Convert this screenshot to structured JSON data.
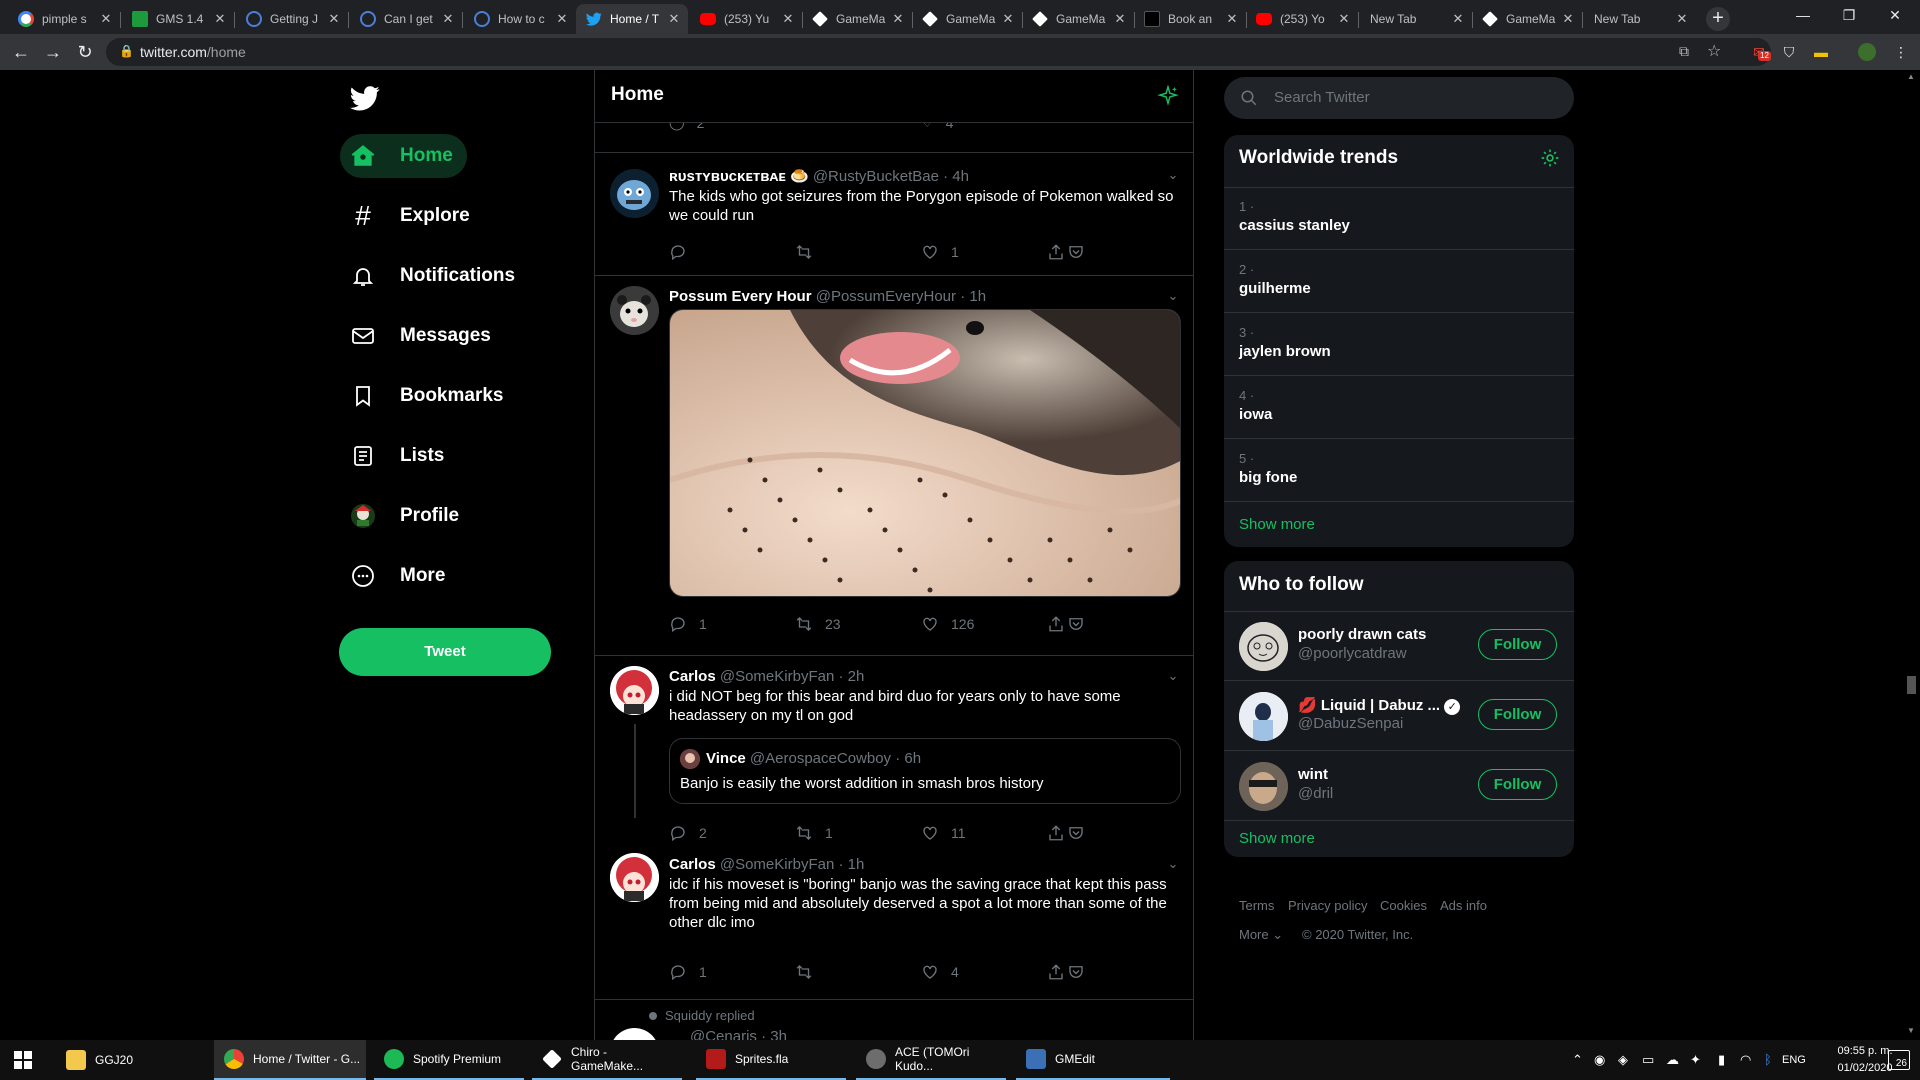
{
  "browser": {
    "tabs": [
      {
        "title": "pimple s"
      },
      {
        "title": "GMS 1.4"
      },
      {
        "title": "Getting J"
      },
      {
        "title": "Can I get"
      },
      {
        "title": "How to c"
      },
      {
        "title": "Home / T"
      },
      {
        "title": "(253) Yu"
      },
      {
        "title": "GameMa"
      },
      {
        "title": "GameMa"
      },
      {
        "title": "GameMa"
      },
      {
        "title": "Book an"
      },
      {
        "title": "(253) Yo"
      },
      {
        "title": "New Tab"
      },
      {
        "title": "GameMa"
      },
      {
        "title": "New Tab"
      }
    ],
    "url_host": "twitter.com",
    "url_path": "/home",
    "extension_badge": "12"
  },
  "nav": {
    "items": [
      {
        "label": "Home",
        "icon": "home-icon"
      },
      {
        "label": "Explore",
        "icon": "hashtag-icon"
      },
      {
        "label": "Notifications",
        "icon": "bell-icon"
      },
      {
        "label": "Messages",
        "icon": "envelope-icon"
      },
      {
        "label": "Bookmarks",
        "icon": "bookmark-icon"
      },
      {
        "label": "Lists",
        "icon": "list-icon"
      },
      {
        "label": "Profile",
        "icon": "profile-avatar-icon"
      },
      {
        "label": "More",
        "icon": "more-icon"
      }
    ],
    "tweet_button": "Tweet"
  },
  "feed": {
    "title": "Home",
    "top_partial_counts": {
      "replies": "2",
      "likes": "4"
    },
    "tweets": [
      {
        "name": "ʀᴜsᴛʏʙᴜᴄᴋᴇᴛʙᴀᴇ 🍮",
        "handle": "@RustyBucketBae",
        "time": "· 4h",
        "text": "The kids who got seizures from the Porygon episode of Pokemon walked so we could run",
        "replies": "",
        "retweets": "",
        "likes": "1"
      },
      {
        "name": "Possum Every Hour",
        "handle": "@PossumEveryHour",
        "time": "· 1h",
        "text": "",
        "replies": "1",
        "retweets": "23",
        "likes": "126"
      },
      {
        "name": "Carlos",
        "handle": "@SomeKirbyFan",
        "time": "· 2h",
        "text": "i did NOT beg for this bear and bird duo for years only to have some headassery on my tl on god",
        "quote": {
          "name": "Vince",
          "handle": "@AerospaceCowboy",
          "time": "· 6h",
          "text": "Banjo is easily the worst addition in smash bros history"
        },
        "replies": "2",
        "retweets": "1",
        "likes": "11"
      },
      {
        "name": "Carlos",
        "handle": "@SomeKirbyFan",
        "time": "· 1h",
        "text": "idc if his moveset is \"boring\" banjo was the saving grace that kept this pass from being mid and absolutely deserved a spot a lot more than some of the other dlc imo",
        "replies": "1",
        "retweets": "",
        "likes": "4"
      }
    ],
    "partial_next": {
      "context": "Squiddy replied",
      "handle": "@Cenaris · 3h"
    }
  },
  "sidebar": {
    "search_placeholder": "Search Twitter",
    "trends": {
      "title": "Worldwide trends",
      "items": [
        {
          "rank": "1 ·",
          "name": "cassius stanley"
        },
        {
          "rank": "2 ·",
          "name": "guilherme"
        },
        {
          "rank": "3 ·",
          "name": "jaylen brown"
        },
        {
          "rank": "4 ·",
          "name": "iowa"
        },
        {
          "rank": "5 ·",
          "name": "big fone"
        }
      ],
      "show_more": "Show more"
    },
    "who_to_follow": {
      "title": "Who to follow",
      "items": [
        {
          "name": "poorly drawn cats",
          "handle": "@poorlycatdraw",
          "button": "Follow"
        },
        {
          "name": "💋 Liquid | Dabuz ...",
          "handle": "@DabuzSenpai",
          "button": "Follow",
          "verified": true
        },
        {
          "name": "wint",
          "handle": "@dril",
          "button": "Follow"
        }
      ],
      "show_more": "Show more"
    },
    "footer": {
      "links": [
        "Terms",
        "Privacy policy",
        "Cookies",
        "Ads info"
      ],
      "more": "More",
      "copyright": "© 2020 Twitter, Inc."
    }
  },
  "taskbar": {
    "apps": [
      {
        "label": "GGJ20"
      },
      {
        "label": "Home / Twitter - G..."
      },
      {
        "label": "Spotify Premium"
      },
      {
        "label": "Chiro - GameMake..."
      },
      {
        "label": "Sprites.fla"
      },
      {
        "label": "ACE (TOMOri Kudo..."
      },
      {
        "label": "GMEdit"
      }
    ],
    "language": "ENG",
    "time": "09:55 p. m.",
    "date": "01/02/2020",
    "notification_count": "26"
  },
  "colors": {
    "accent": "#17bf63",
    "background": "#000000",
    "panel": "#15181c",
    "muted": "#6e767d"
  }
}
